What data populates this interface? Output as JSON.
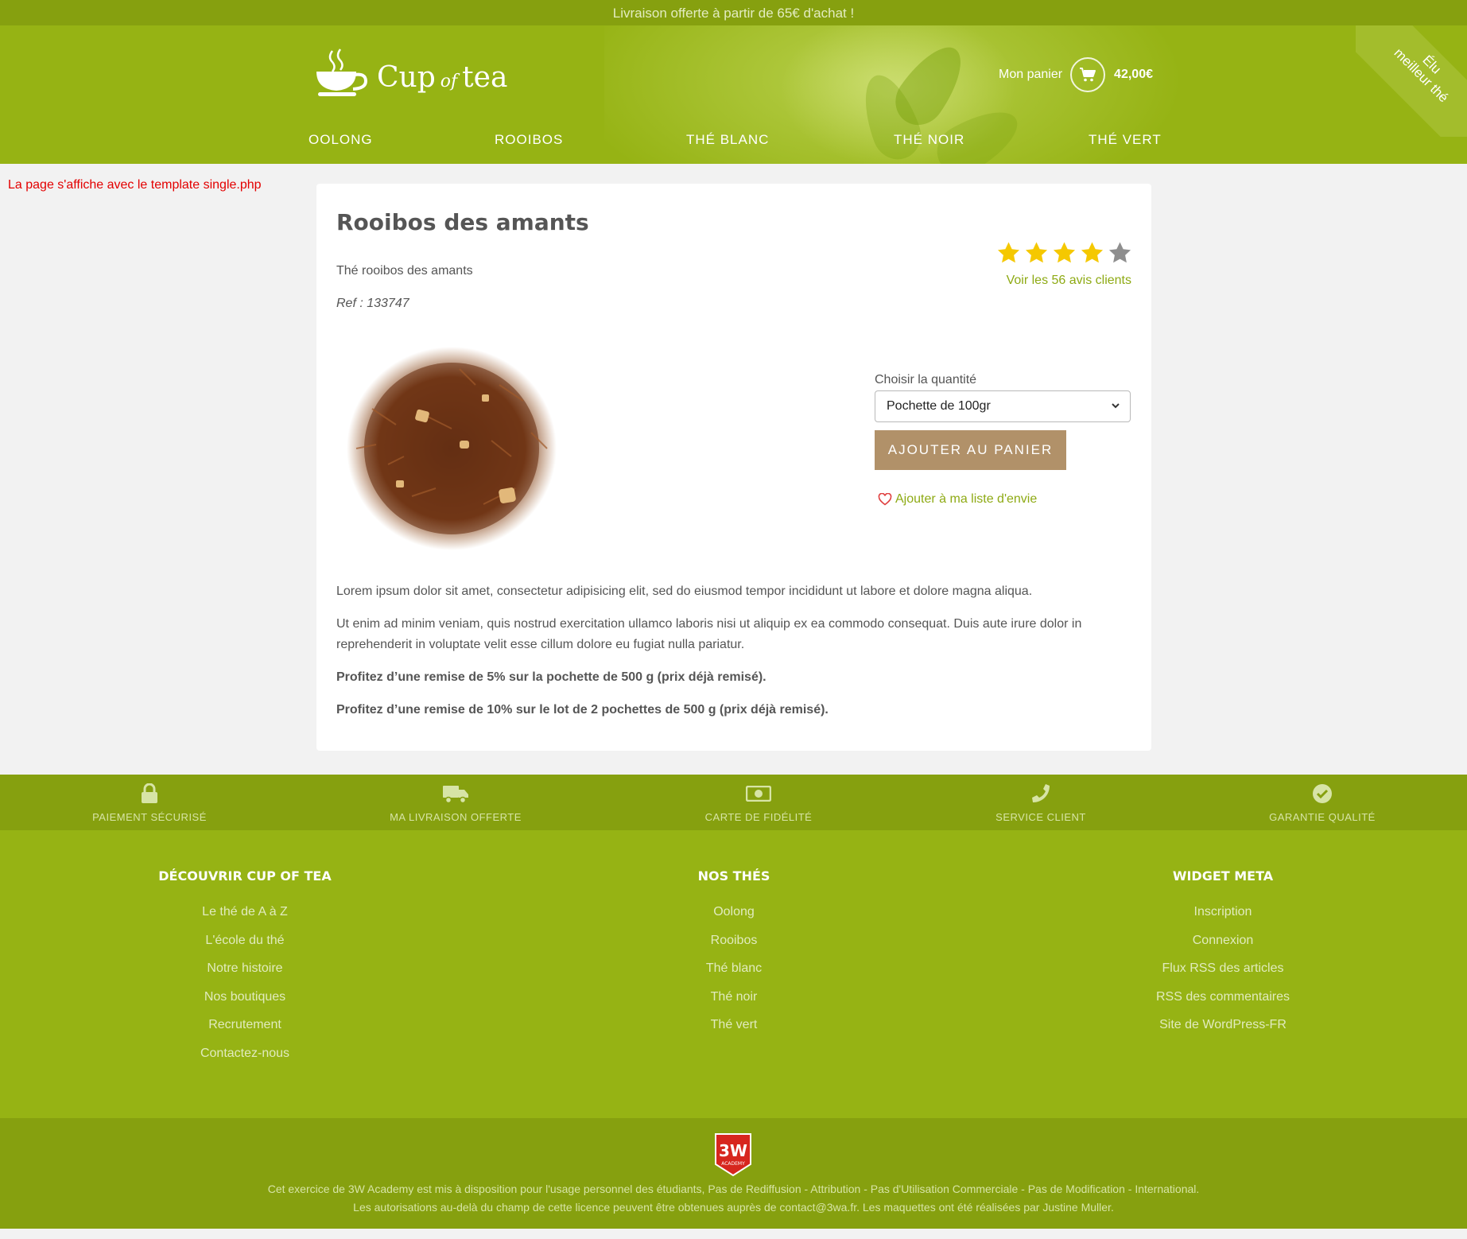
{
  "topbar": {
    "text": "Livraison offerte à partir de 65€ d'achat !"
  },
  "header": {
    "logo": {
      "word1": "Cup",
      "word2": "of",
      "word3": "tea"
    },
    "cart": {
      "label": "Mon panier",
      "amount": "42,00€"
    },
    "ribbon": {
      "line1": "Élu",
      "line2": "meilleur thé"
    },
    "nav": [
      "OOLONG",
      "ROOIBOS",
      "THÉ BLANC",
      "THÉ NOIR",
      "THÉ VERT"
    ]
  },
  "notice": "La page s'affiche avec le template single.php",
  "product": {
    "title": "Rooibos des amants",
    "subtitle": "Thé rooibos des amants",
    "ref": "Ref : 133747",
    "rating": {
      "filled": 4,
      "total": 5,
      "reviews_link": "Voir les 56 avis clients"
    },
    "quantity_label": "Choisir la quantité",
    "quantity_selected": "Pochette de 100gr",
    "add_to_cart": "AJOUTER AU PANIER",
    "wishlist": "Ajouter à ma liste d'envie",
    "description": [
      "Lorem ipsum dolor sit amet, consectetur adipisicing elit, sed do eiusmod tempor incididunt ut labore et dolore magna aliqua.",
      "Ut enim ad minim veniam, quis nostrud exercitation ullamco laboris nisi ut aliquip ex ea commodo consequat. Duis aute irure dolor in reprehenderit in voluptate velit esse cillum dolore eu fugiat nulla pariatur."
    ],
    "offers": [
      "Profitez d’une remise de 5% sur la pochette de 500 g (prix déjà remisé).",
      "Profitez d’une remise de 10% sur le lot de 2 pochettes de 500 g (prix déjà remisé)."
    ]
  },
  "reassurance": [
    {
      "icon": "lock-icon",
      "label": "PAIEMENT SÉCURISÉ"
    },
    {
      "icon": "truck-icon",
      "label": "MA LIVRAISON OFFERTE"
    },
    {
      "icon": "banknote-icon",
      "label": "CARTE DE FIDÉLITÉ"
    },
    {
      "icon": "phone-icon",
      "label": "SERVICE CLIENT"
    },
    {
      "icon": "check-circle-icon",
      "label": "GARANTIE QUALITÉ"
    }
  ],
  "footer": {
    "col1": {
      "title": "DÉCOUVRIR CUP OF TEA",
      "links": [
        "Le thé de A à Z",
        "L'école du thé",
        "Notre histoire",
        "Nos boutiques",
        "Recrutement",
        "Contactez-nous"
      ]
    },
    "col2": {
      "title": "NOS THÉS",
      "links": [
        "Oolong",
        "Rooibos",
        "Thé blanc",
        "Thé noir",
        "Thé vert"
      ]
    },
    "col3": {
      "title": "WIDGET META",
      "links": [
        "Inscription",
        "Connexion",
        "Flux RSS des articles",
        "RSS des commentaires",
        "Site de WordPress-FR"
      ]
    }
  },
  "legal": {
    "badge_top": "3W",
    "badge_bottom": "ACADEMY",
    "line1": "Cet exercice de 3W Academy est mis à disposition pour l'usage personnel des étudiants, Pas de Rediffusion - Attribution - Pas d'Utilisation Commerciale - Pas de Modification - International.",
    "line2": "Les autorisations au-delà du champ de cette licence peuvent être obtenues auprès de contact@3wa.fr. Les maquettes ont été réalisées par Justine Muller."
  },
  "colors": {
    "green": "#96b314",
    "dark_green": "#86a00f",
    "accent_text": "#8eaa14",
    "button": "#b19169",
    "star": "#f5c800",
    "notice": "#e30000"
  }
}
